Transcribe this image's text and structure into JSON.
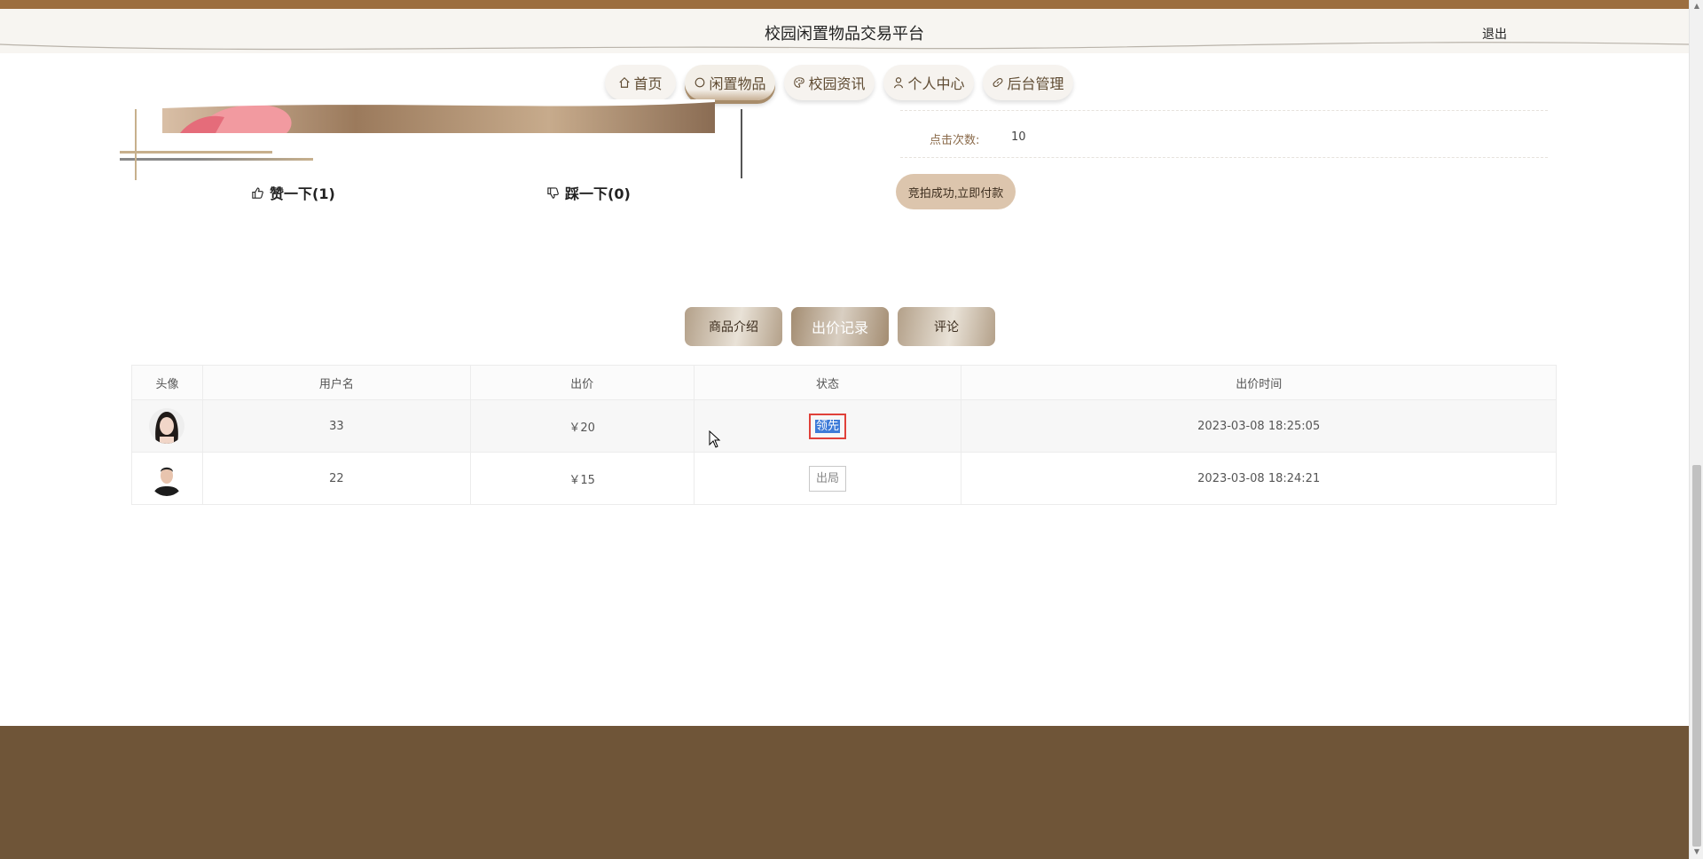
{
  "header": {
    "site_title": "校园闲置物品交易平台",
    "logout_label": "退出"
  },
  "nav": {
    "items": [
      {
        "label": "首页",
        "icon": "home-icon"
      },
      {
        "label": "闲置物品",
        "icon": "circle-icon",
        "active": true
      },
      {
        "label": "校园资讯",
        "icon": "palette-icon"
      },
      {
        "label": "个人中心",
        "icon": "user-icon"
      },
      {
        "label": "后台管理",
        "icon": "link-icon"
      }
    ]
  },
  "product": {
    "like_label": "赞一下(1)",
    "dislike_label": "踩一下(0)",
    "click_label": "点击次数:",
    "click_value": "10",
    "pay_button": "竞拍成功,立即付款"
  },
  "tabs": [
    {
      "label": "商品介绍"
    },
    {
      "label": "出价记录",
      "active": true
    },
    {
      "label": "评论"
    }
  ],
  "bid_table": {
    "headers": [
      "头像",
      "用户名",
      "出价",
      "状态",
      "出价时间"
    ],
    "rows": [
      {
        "username": "33",
        "price": "￥20",
        "status": "领先",
        "time": "2023-03-08 18:25:05"
      },
      {
        "username": "22",
        "price": "￥15",
        "status": "出局",
        "time": "2023-03-08 18:24:21"
      }
    ]
  },
  "colors": {
    "accent": "#9c6e3f",
    "footer": "#6f5538",
    "nav_text": "#5f4b32",
    "lead_border": "#e0413a",
    "selection": "#3e7bd8"
  }
}
